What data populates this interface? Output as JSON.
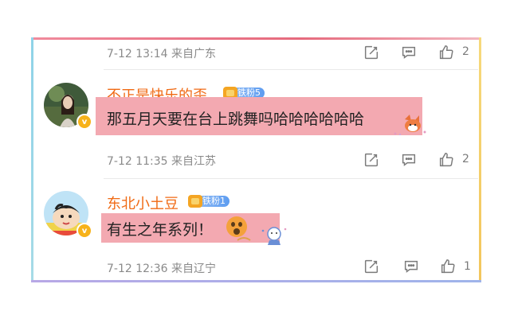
{
  "comments": [
    {
      "meta": "7-12 13:14 来自广东",
      "like_count": "2"
    },
    {
      "username": "不正是快乐的歪",
      "fan_badge": "铁粉5",
      "text": "那五月天要在台上跳舞吗哈哈哈哈哈哈",
      "meta": "7-12 11:35 来自江苏",
      "like_count": "2",
      "verified_badge": "v"
    },
    {
      "username": "东北小土豆",
      "fan_badge": "铁粉1",
      "text": "有生之年系列！",
      "meta": "7-12 12:36 来自辽宁",
      "like_count": "1",
      "verified_badge": "v"
    }
  ],
  "icons": {
    "repost": "share-square-icon",
    "comment": "chat-bubble-icon",
    "like": "thumbs-up-icon"
  },
  "colors": {
    "username": "#f06a14",
    "highlight": "#f3a9b1",
    "verified": "#f7b21a",
    "meta": "#8a8a8a"
  }
}
